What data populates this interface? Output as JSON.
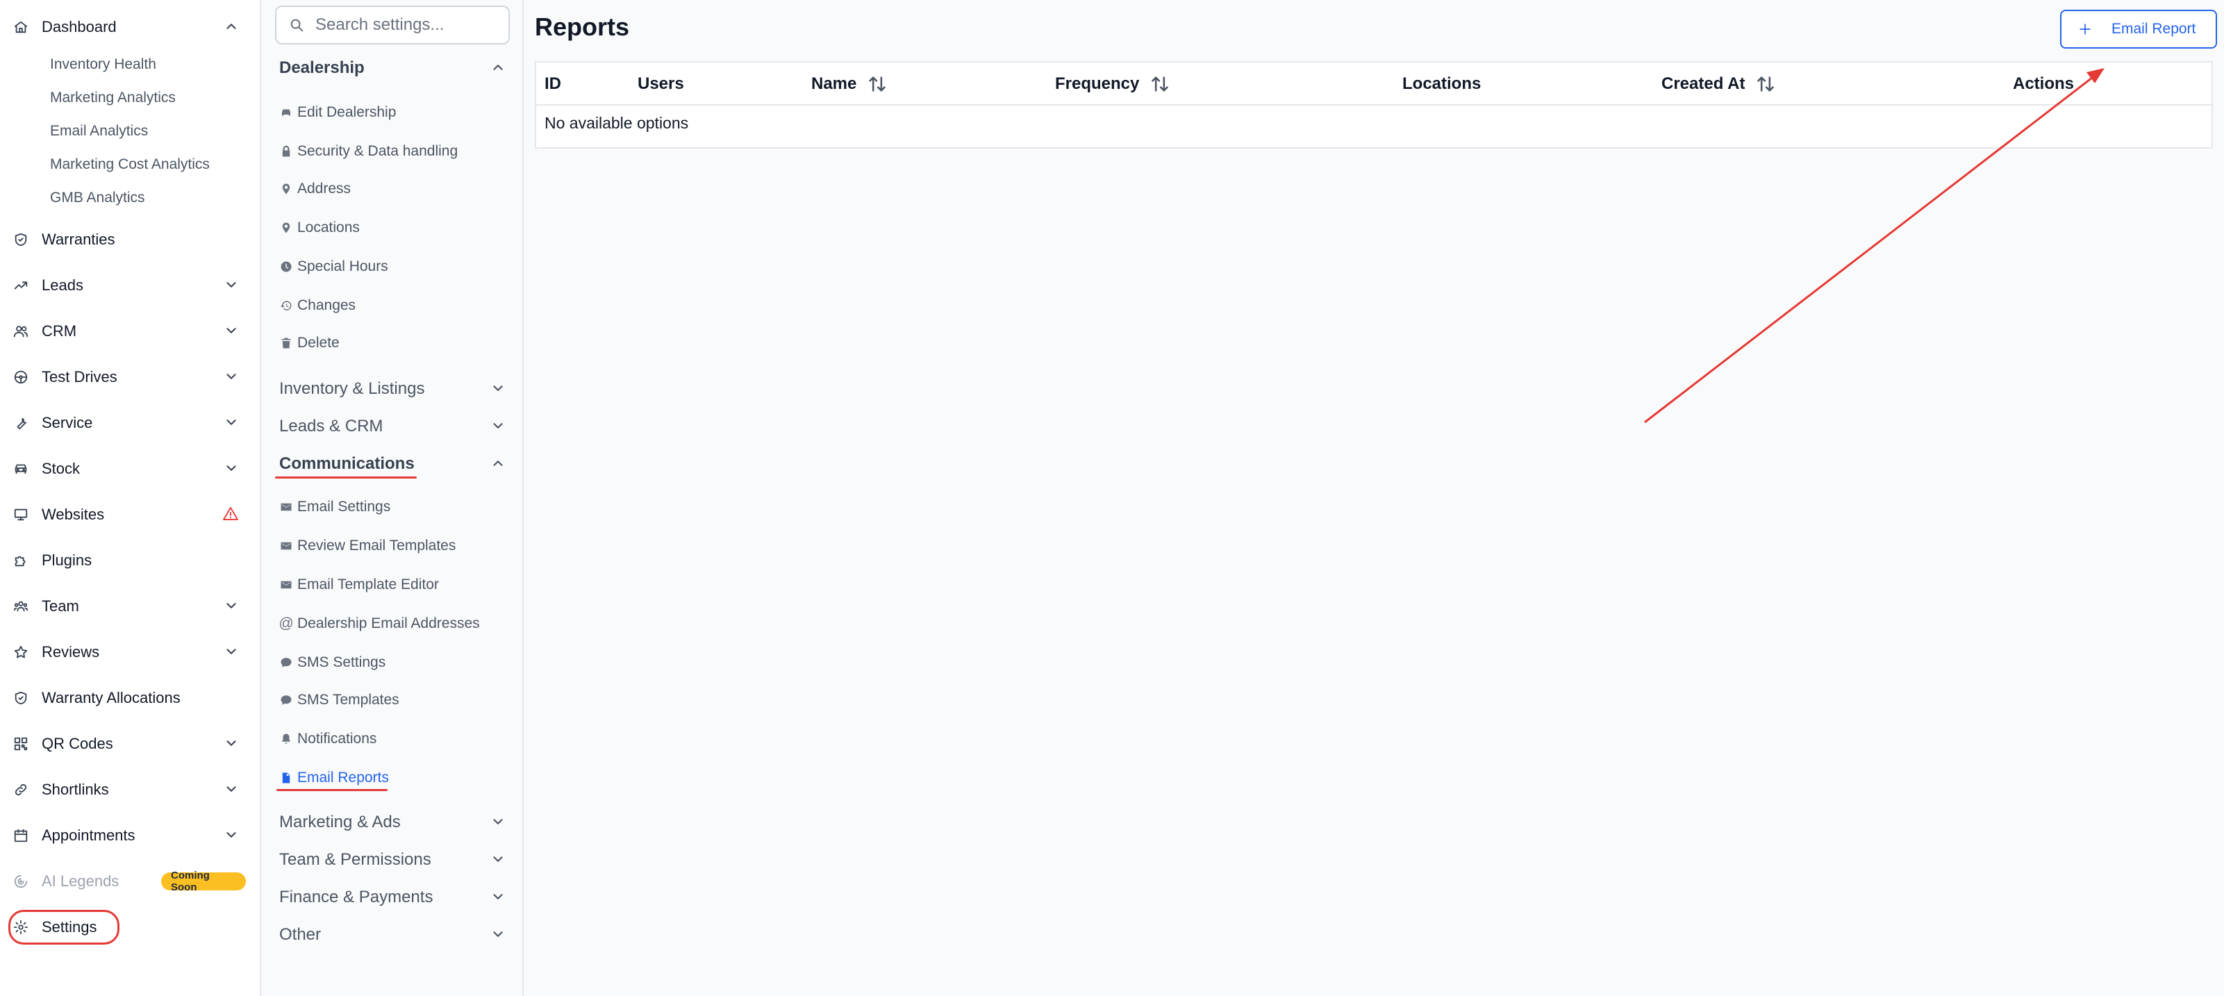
{
  "sidebar": {
    "dashboard": "Dashboard",
    "dashboard_sub": [
      "Inventory Health",
      "Marketing Analytics",
      "Email Analytics",
      "Marketing Cost Analytics",
      "GMB Analytics"
    ],
    "warranties": "Warranties",
    "leads": "Leads",
    "crm": "CRM",
    "test_drives": "Test Drives",
    "service": "Service",
    "stock": "Stock",
    "websites": "Websites",
    "plugins": "Plugins",
    "team": "Team",
    "reviews": "Reviews",
    "warranty_allocations": "Warranty Allocations",
    "qr_codes": "QR Codes",
    "shortlinks": "Shortlinks",
    "appointments": "Appointments",
    "ai_legends": "AI Legends",
    "coming_soon": "Coming Soon",
    "settings": "Settings"
  },
  "settings_panel": {
    "search_placeholder": "Search settings...",
    "dealership": {
      "title": "Dealership",
      "items": [
        "Edit Dealership",
        "Security & Data handling",
        "Address",
        "Locations",
        "Special Hours",
        "Changes",
        "Delete"
      ]
    },
    "inventory_listings": "Inventory & Listings",
    "leads_crm": "Leads & CRM",
    "communications": {
      "title": "Communications",
      "items": [
        "Email Settings",
        "Review Email Templates",
        "Email Template Editor",
        "Dealership Email Addresses",
        "SMS Settings",
        "SMS Templates",
        "Notifications",
        "Email Reports"
      ]
    },
    "marketing_ads": "Marketing & Ads",
    "team_permissions": "Team & Permissions",
    "finance_payments": "Finance & Payments",
    "other": "Other"
  },
  "main": {
    "title": "Reports",
    "add_button": "Email Report",
    "columns": [
      "ID",
      "Users",
      "Name",
      "Frequency",
      "Locations",
      "Created At",
      "Actions"
    ],
    "empty_message": "No available options"
  },
  "colors": {
    "accent": "#2563eb",
    "annotation": "#e53935",
    "badge": "#fbbf24"
  }
}
